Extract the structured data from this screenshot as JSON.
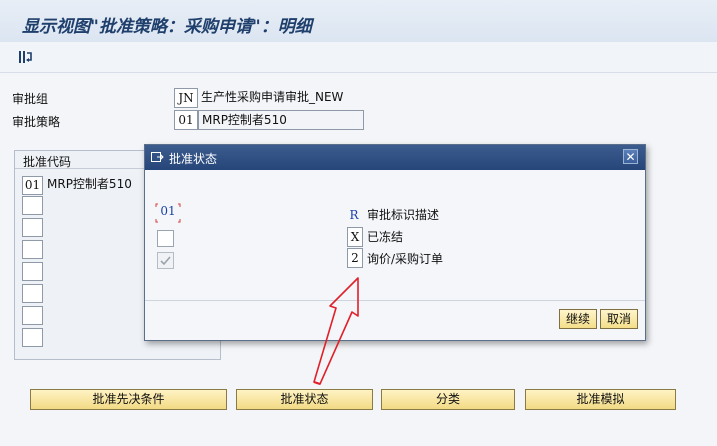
{
  "window": {
    "title": "显示视图\"批准策略：采购申请\"：明细"
  },
  "toolbar": {
    "icon": "exit-icon"
  },
  "header": {
    "release_group_label": "审批组",
    "release_group_code": "JN",
    "release_group_desc": "生产性采购申请审批_NEW",
    "release_strategy_label": "审批策略",
    "release_strategy_code": "01",
    "release_strategy_desc": "MRP控制者510"
  },
  "release_codes": {
    "title": "批准代码",
    "rows": [
      {
        "code": "01",
        "desc": "MRP控制者510"
      }
    ]
  },
  "dialog": {
    "title": "批准状态",
    "code": "01",
    "r_code": "R",
    "r_desc": "审批标识描述",
    "x_code": "X",
    "x_desc": "已冻结",
    "two_code": "2",
    "two_desc": "询价/采购订单",
    "continue_label": "继续",
    "cancel_label": "取消",
    "checkbox2_checked": true
  },
  "buttons": {
    "prereq": "批准先决条件",
    "status": "批准状态",
    "classification": "分类",
    "simulation": "批准模拟"
  },
  "annotation": {
    "arrow_color": "#e0202a"
  }
}
